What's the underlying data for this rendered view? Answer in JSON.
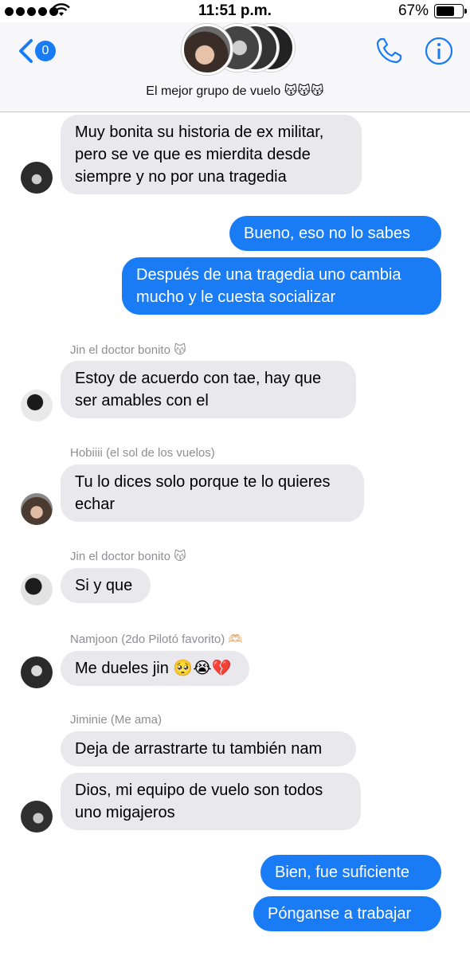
{
  "status_bar": {
    "time": "11:51 p.m.",
    "battery": "67%"
  },
  "header": {
    "back_count": "0",
    "group_name": "El mejor grupo de vuelo 😽😽😽"
  },
  "messages": [
    {
      "text": "Muy bonita su historia de ex militar, pero se ve que es mierdita desde siempre y no por una tragedia"
    },
    {
      "text": "Bueno, eso no lo sabes"
    },
    {
      "text": "Después de una tragedia uno cambia mucho y le cuesta socializar"
    },
    {
      "sender": "Jin el doctor bonito 😽",
      "text": "Estoy de acuerdo con tae, hay que ser amables con el"
    },
    {
      "sender": "Hobiiii (el sol de los vuelos)",
      "text": "Tu lo dices solo porque te lo quieres echar"
    },
    {
      "sender": "Jin el doctor bonito 😽",
      "text": "Si y que"
    },
    {
      "sender": "Namjoon (2do Pilotó favorito) 🫶🏻",
      "text": "Me dueles jin 🥺😭💔"
    },
    {
      "sender": "Jiminie (Me ama)",
      "text": "Deja de arrastrarte tu también nam"
    },
    {
      "text": "Dios, mi equipo de vuelo son todos uno migajeros"
    },
    {
      "text": "Bien, fue suficiente"
    },
    {
      "text": "Pónganse a trabajar"
    }
  ],
  "colors": {
    "accent": "#1a7cf5",
    "incoming_bubble": "#e8e8ed"
  },
  "icons": [
    "back-chevron-icon",
    "phone-icon",
    "info-icon",
    "wifi-icon",
    "battery-icon"
  ]
}
